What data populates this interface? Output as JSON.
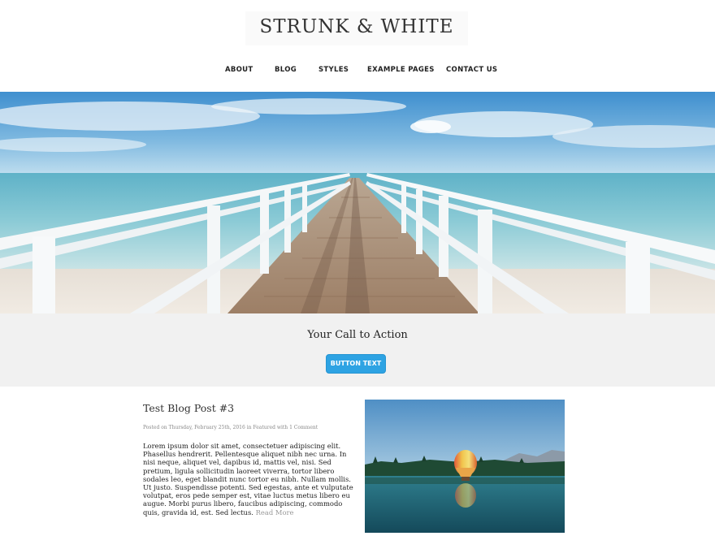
{
  "site": {
    "title": "STRUNK & WHITE"
  },
  "nav": {
    "items": [
      {
        "label": "ABOUT"
      },
      {
        "label": "BLOG"
      },
      {
        "label": "STYLES"
      },
      {
        "label": "EXAMPLE PAGES"
      },
      {
        "label": "CONTACT US"
      }
    ]
  },
  "hero": {
    "image": "pier-over-ocean-image"
  },
  "cta": {
    "title": "Your Call to Action",
    "button_label": "BUTTON TEXT",
    "button_color": "#2ea3e3",
    "background": "#f1f1f1"
  },
  "post": {
    "title": "Test Blog Post #3",
    "meta_prefix": "Posted on ",
    "meta_date": "Thursday, February 25th, 2016",
    "meta_in": " in ",
    "meta_category": "Featured",
    "meta_with": " with ",
    "meta_comments": "1 Comment",
    "excerpt": "Lorem ipsum dolor sit amet, consectetuer adipiscing elit. Phasellus hendrerit. Pellentesque aliquet nibh nec urna. In nisi neque, aliquet vel, dapibus id, mattis vel, nisi. Sed pretium, ligula sollicitudin laoreet viverra, tortor libero sodales leo, eget blandit nunc tortor eu nibh. Nullam mollis. Ut justo. Suspendisse potenti. Sed egestas, ante et vulputate volutpat, eros pede semper est, vitae luctus metus libero eu augue. Morbi purus libero, faucibus adipiscing, commodo quis, gravida id, est. Sed lectus.",
    "read_more": "Read More",
    "image": "hot-air-balloon-lake-image"
  }
}
